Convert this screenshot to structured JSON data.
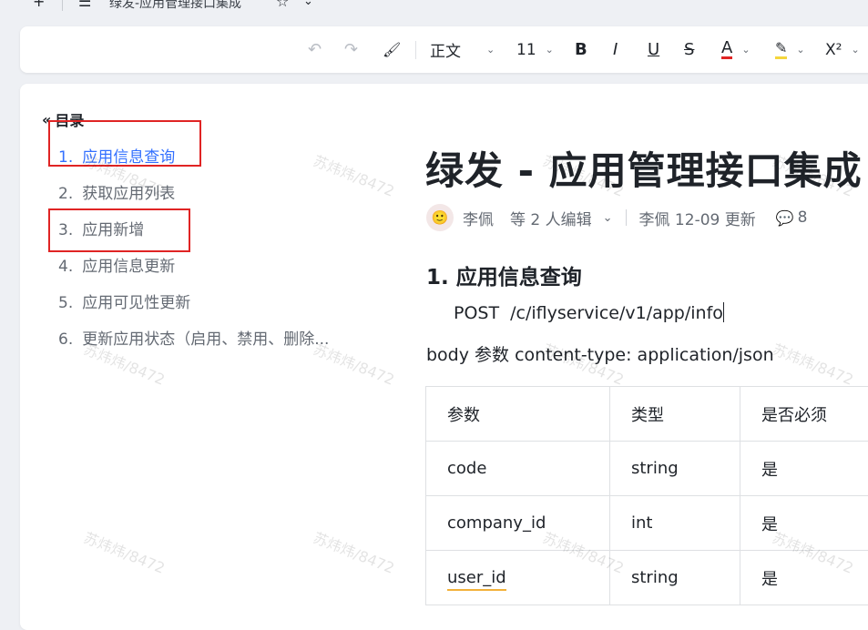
{
  "title_bar": {
    "add_icon": "+",
    "menu_icon": "☰",
    "doc_title": "绿发-应用管理接口集成",
    "star_icon": "☆",
    "chevron_icon": "⌄"
  },
  "toolbar": {
    "undo": "↶",
    "redo": "↷",
    "format_painter": "🖌",
    "style": "正文",
    "font_size": "11",
    "bold": "B",
    "italic": "I",
    "underline": "U",
    "strikethrough": "S",
    "font_color": "A",
    "highlight": "✎",
    "superscript": "X²",
    "caret": "⌄"
  },
  "outline": {
    "header_icon": "«",
    "header": "目录",
    "items": [
      {
        "num": "1.",
        "label": "应用信息查询"
      },
      {
        "num": "2.",
        "label": "获取应用列表"
      },
      {
        "num": "3.",
        "label": "应用新增"
      },
      {
        "num": "4.",
        "label": "应用信息更新"
      },
      {
        "num": "5.",
        "label": "应用可见性更新"
      },
      {
        "num": "6.",
        "label": "更新应用状态（启用、禁用、删除..."
      }
    ]
  },
  "document": {
    "title": "绿发 - 应用管理接口集成",
    "meta": {
      "author": "李佩",
      "editors": "等 2 人编辑",
      "updated": "李佩 12-09 更新",
      "comment_count": "8"
    },
    "section_heading": "1. 应用信息查询",
    "endpoint": "POST  /c/iflyservice/v1/app/info",
    "body_line": "body 参数  content-type: application/json",
    "table": {
      "headers": [
        "参数",
        "类型",
        "是否必须"
      ],
      "rows": [
        [
          "code",
          "string",
          "是"
        ],
        [
          "company_id",
          "int",
          "是"
        ],
        [
          "user_id",
          "string",
          "是"
        ]
      ]
    }
  },
  "watermark": "苏炜炜/8472",
  "colors": {
    "accent": "#3370ff",
    "highlight_box": "#e02424",
    "background": "#eef0f4"
  }
}
